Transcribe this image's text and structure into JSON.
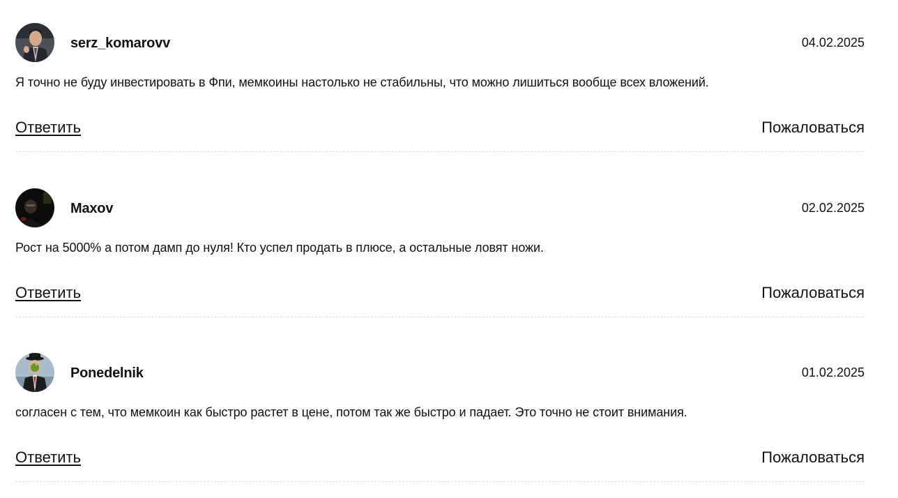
{
  "comments": [
    {
      "author": "serz_komarovv",
      "date": "04.02.2025",
      "text": "Я точно не буду инвестировать в Фпи, мемкоины настолько не стабильны, что можно лишиться вообще всех вложений.",
      "reply_label": "Ответить",
      "report_label": "Пожаловаться",
      "avatar_icon": "user-avatar-man-in-suit"
    },
    {
      "author": "Maxov",
      "date": "02.02.2025",
      "text": "Рост на 5000% а потом дамп до нуля! Кто успел продать в плюсе, а остальные ловят ножи.",
      "reply_label": "Ответить",
      "report_label": "Пожаловаться",
      "avatar_icon": "user-avatar-dark-portrait"
    },
    {
      "author": "Ponedelnik",
      "date": "01.02.2025",
      "text": "согласен с тем, что мемкоин как быстро растет в цене, потом так же быстро и падает. Это точно не стоит внимания.",
      "reply_label": "Ответить",
      "report_label": "Пожаловаться",
      "avatar_icon": "user-avatar-son-of-man-painting"
    }
  ]
}
